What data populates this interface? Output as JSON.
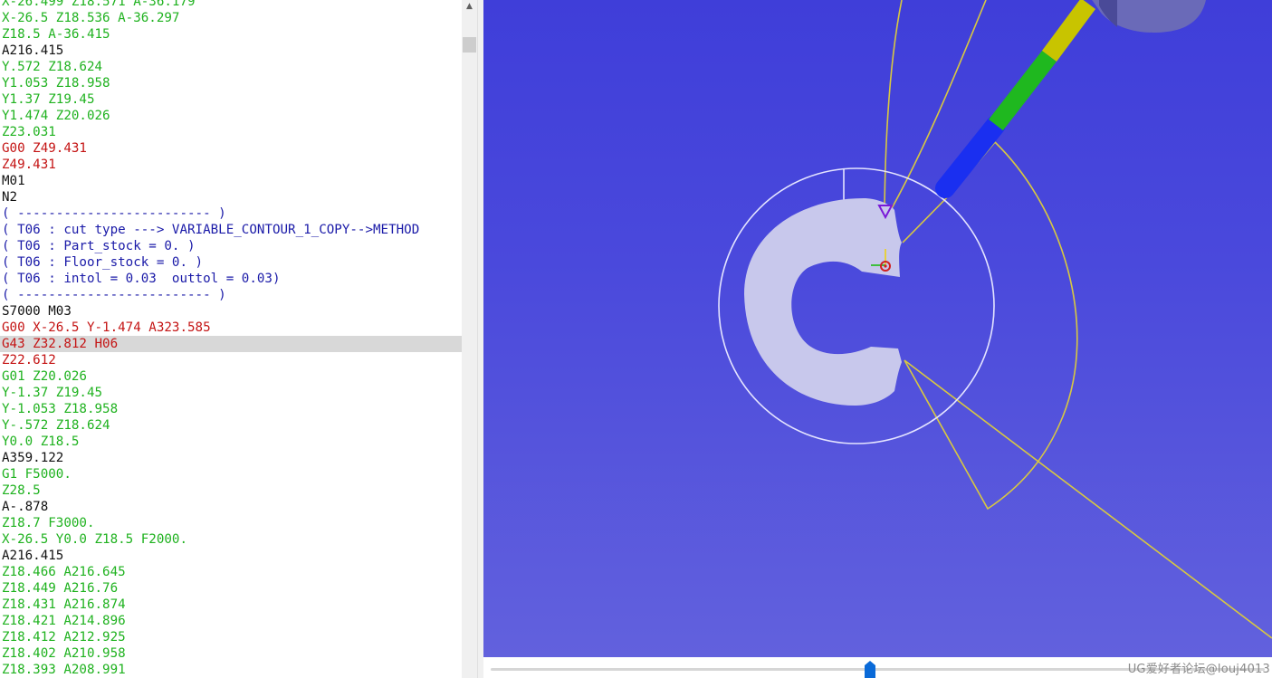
{
  "code_lines": [
    {
      "text": "X-26.499 Z18.571 A-36.179",
      "color": "green"
    },
    {
      "text": "X-26.5 Z18.536 A-36.297",
      "color": "green"
    },
    {
      "text": "Z18.5 A-36.415",
      "color": "green"
    },
    {
      "text": "A216.415",
      "color": "black"
    },
    {
      "text": "Y.572 Z18.624",
      "color": "green"
    },
    {
      "text": "Y1.053 Z18.958",
      "color": "green"
    },
    {
      "text": "Y1.37 Z19.45",
      "color": "green"
    },
    {
      "text": "Y1.474 Z20.026",
      "color": "green"
    },
    {
      "text": "Z23.031",
      "color": "green"
    },
    {
      "text": "G00 Z49.431",
      "color": "red"
    },
    {
      "text": "Z49.431",
      "color": "red"
    },
    {
      "text": "M01",
      "color": "black"
    },
    {
      "text": "N2",
      "color": "black"
    },
    {
      "text": "( ------------------------- )",
      "color": "blue"
    },
    {
      "text": "( T06 : cut type ---> VARIABLE_CONTOUR_1_COPY-->METHOD",
      "color": "blue"
    },
    {
      "text": "( T06 : Part_stock = 0. )",
      "color": "blue"
    },
    {
      "text": "( T06 : Floor_stock = 0. )",
      "color": "blue"
    },
    {
      "text": "( T06 : intol = 0.03  outtol = 0.03)",
      "color": "blue"
    },
    {
      "text": "( ------------------------- )",
      "color": "blue"
    },
    {
      "text": "S7000 M03",
      "color": "black"
    },
    {
      "text": "G00 X-26.5 Y-1.474 A323.585",
      "color": "red"
    },
    {
      "text": "G43 Z32.812 H06",
      "color": "red",
      "highlighted": true
    },
    {
      "text": "Z22.612",
      "color": "red"
    },
    {
      "text": "G01 Z20.026",
      "color": "green"
    },
    {
      "text": "Y-1.37 Z19.45",
      "color": "green"
    },
    {
      "text": "Y-1.053 Z18.958",
      "color": "green"
    },
    {
      "text": "Y-.572 Z18.624",
      "color": "green"
    },
    {
      "text": "Y0.0 Z18.5",
      "color": "green"
    },
    {
      "text": "A359.122",
      "color": "black"
    },
    {
      "text": "G1 F5000.",
      "color": "green"
    },
    {
      "text": "Z28.5",
      "color": "green"
    },
    {
      "text": "A-.878",
      "color": "black"
    },
    {
      "text": "Z18.7 F3000.",
      "color": "green"
    },
    {
      "text": "X-26.5 Y0.0 Z18.5 F2000.",
      "color": "green"
    },
    {
      "text": "A216.415",
      "color": "black"
    },
    {
      "text": "Z18.466 A216.645",
      "color": "green"
    },
    {
      "text": "Z18.449 A216.76",
      "color": "green"
    },
    {
      "text": "Z18.431 A216.874",
      "color": "green"
    },
    {
      "text": "Z18.421 A214.896",
      "color": "green"
    },
    {
      "text": "Z18.412 A212.925",
      "color": "green"
    },
    {
      "text": "Z18.402 A210.958",
      "color": "green"
    },
    {
      "text": "Z18.393 A208.991",
      "color": "green"
    }
  ],
  "colors": {
    "green": "#1fb21f",
    "red": "#c41414",
    "black": "#111111",
    "blue": "#1a1aa8",
    "viewport_top": "#3f3ed9",
    "viewport_bottom": "#6261dd",
    "toolpath": "#d8c840",
    "part": "#c8c8ec",
    "tool_blue": "#1a2ff0",
    "tool_green": "#1fb81f",
    "tool_yellow": "#c8c400",
    "holder": "#6a6ab8"
  },
  "icons": {
    "scroll_up": "chevron-up-icon",
    "slider_thumb": "slider-thumb-icon",
    "tool_marker": "tool-position-marker-icon"
  },
  "simulation": {
    "slider_position_fraction": 0.49
  },
  "watermark": "UG爱好者论坛@louj4013"
}
